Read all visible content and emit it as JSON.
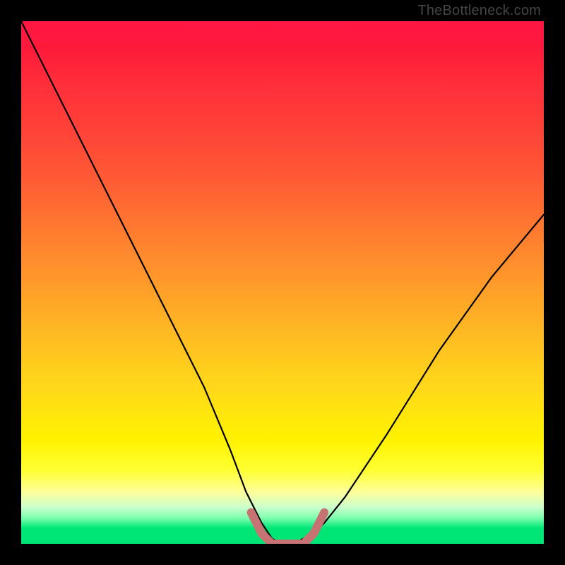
{
  "watermark": "TheBottleneck.com",
  "colors": {
    "frame": "#000000",
    "curve_black": "#000000",
    "marker": "#c87373",
    "gradient": [
      "#ff1744",
      "#ff5a35",
      "#ff9a2a",
      "#ffd81a",
      "#ffff33",
      "#ccffcc",
      "#00e676"
    ]
  },
  "chart_data": {
    "type": "line",
    "title": "",
    "xlabel": "",
    "ylabel": "",
    "xlim": [
      0,
      100
    ],
    "ylim": [
      0,
      100
    ],
    "legend": false,
    "grid": false,
    "annotations": [
      "TheBottleneck.com"
    ],
    "series": [
      {
        "name": "bottleneck-curve",
        "color": "#000000",
        "x": [
          0,
          5,
          10,
          15,
          20,
          25,
          30,
          35,
          40,
          43,
          46,
          48,
          50,
          52,
          54,
          56,
          58,
          62,
          66,
          70,
          75,
          80,
          85,
          90,
          95,
          100
        ],
        "values": [
          100,
          90,
          80,
          70,
          60,
          50,
          40,
          30,
          18,
          10,
          4,
          1,
          0,
          0,
          1,
          2,
          4,
          9,
          15,
          21,
          29,
          37,
          44,
          51,
          57,
          63
        ]
      },
      {
        "name": "optimal-range-marker",
        "color": "#c87373",
        "x": [
          44,
          46,
          48,
          50,
          52,
          54,
          56,
          58
        ],
        "values": [
          6,
          2,
          0,
          0,
          0,
          0,
          2,
          6
        ]
      }
    ]
  }
}
